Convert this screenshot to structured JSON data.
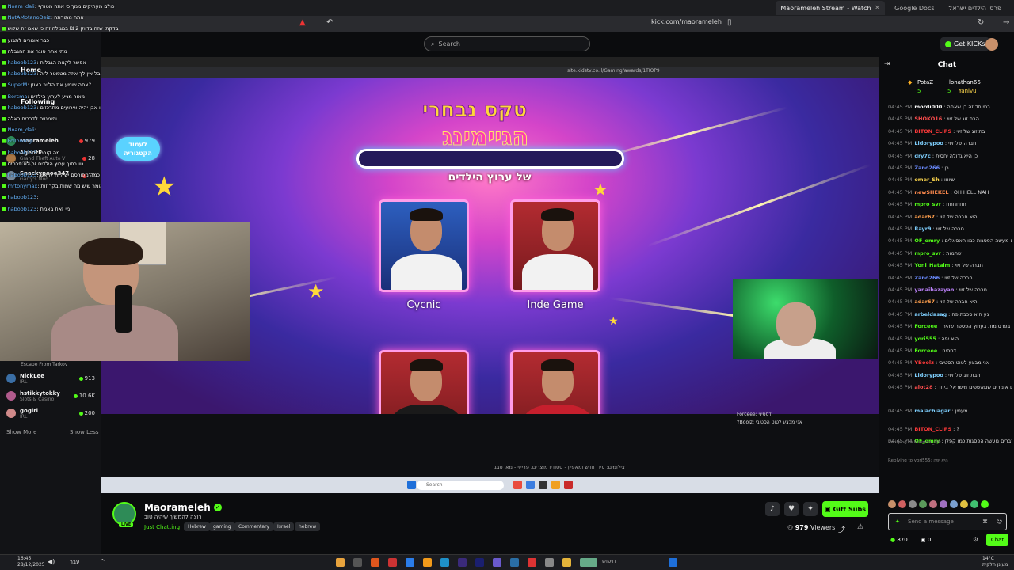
{
  "browser": {
    "tabs": [
      {
        "label": "Maorameleh Stream - Watch",
        "active": true
      },
      {
        "label": "Google Docs",
        "active": false
      },
      {
        "label": "פרסי הילדים ישראל",
        "active": false
      }
    ],
    "url": "kick.com/maorameleh"
  },
  "kick_header": {
    "search_placeholder": "Search",
    "get_kicks_label": "Get KICKs"
  },
  "sidebar": {
    "home": "Home",
    "following": "Following",
    "channels": [
      {
        "name": "Maorameleh",
        "category": "",
        "viewers": "979"
      },
      {
        "name": "AgentF",
        "category": "Grand Theft Auto V (GTA)",
        "viewers": "28"
      },
      {
        "name": "Snackypooe247",
        "category": "Garry's Mod",
        "viewers": "10"
      },
      {
        "name": "Escape From Tarkov",
        "category": "",
        "viewers": ""
      },
      {
        "name": "NickLee",
        "category": "IRL",
        "viewers": "913"
      },
      {
        "name": "hstikkytokky",
        "category": "Slots & Casino",
        "viewers": "10.6K"
      },
      {
        "name": "gogirl",
        "category": "IRL",
        "viewers": "200"
      }
    ],
    "show_more": "Show More",
    "show_less": "Show Less"
  },
  "overlay_chat": [
    {
      "user": "Noam_dali",
      "text": "כולם מעתיקים ממך כי אתה מטורף"
    },
    {
      "user": "NotAMotanoDeiz",
      "text": "אתה מתורתה"
    },
    {
      "user": "",
      "text": "בדקתי שזה בדיוק 2 ₪ במגילה זה כי שאם זה שלוש"
    },
    {
      "user": "",
      "text": "כבר אומרים לתבוע"
    },
    {
      "user": "",
      "text": "מתי אתה סוגר את ההגבלה"
    },
    {
      "user": "haboob123",
      "text": "אפשר לקנות הגבלות"
    },
    {
      "user": "haboob123",
      "text": "הבל אין לך איזה מטמטר לזה"
    },
    {
      "user": "SuperM",
      "text": "אתה שומע את הלייב באוזן?"
    },
    {
      "user": "Borsma",
      "text": "מאור מגיע לערוץ הילדים"
    },
    {
      "user": "haboob123",
      "text": "רק ברגע שהקטגוריה תהיה מאושרת כמו אבן יהיה אירועים מתרכזים"
    },
    {
      "user": "",
      "text": "ופומטים לדברים כאלה"
    },
    {
      "user": "Noam_dali",
      "text": ""
    },
    {
      "user": "Followingl",
      "text": ""
    },
    {
      "user": "haboob123",
      "text": "מה קורה"
    },
    {
      "user": "",
      "text": "טו בתוך ערוץ הילדים זה לא פרסים"
    },
    {
      "user": "haboob123",
      "text": "שתראה כמה מפורסם יש לזה לראש"
    },
    {
      "user": "mrtonymax",
      "text": "מה אומר שיש מה שמות בקרוזות?"
    },
    {
      "user": "haboob123",
      "text": ""
    },
    {
      "user": "haboob123",
      "text": "מי זאת באמת"
    }
  ],
  "video": {
    "inner_url": "site.kidstv.co.il/Gaming/awards/1TIOP9",
    "inner_button": "לעמוד הקטגוריה",
    "logo_line1": "טקס נבחרי",
    "logo_line2": "הגיימינג",
    "subtitle": "של ערוץ הילדים",
    "nominees": [
      {
        "name": "Cycnic"
      },
      {
        "name": "Inde Game"
      },
      {
        "name": ""
      },
      {
        "name": ""
      }
    ],
    "ticker": "צילומים: עידן חדש ומאפיין - סטודיו מוצרים, פרייזי - מאי סבג",
    "mini_legend": [
      "Forceee: דססיני",
      "YBoolz: אני מבצע לטוט הסטיבי"
    ],
    "inner_taskbar_search": "Search"
  },
  "stream_info": {
    "streamer": "Maorameleh",
    "live_badge": "LIVE",
    "title": "רוצה להמשיך שיהיה טוב",
    "category": "Just Chatting",
    "tags": [
      "Hebrew",
      "gaming",
      "Commentary",
      "Israel",
      "hebrew"
    ],
    "gift_subs": "Gift Subs",
    "viewers_count": "979",
    "viewers_label": "Viewers"
  },
  "chat": {
    "title": "Chat",
    "pinned": [
      {
        "user": "PotaZ",
        "count": "5"
      },
      {
        "user": "lonathan66",
        "count": "5"
      },
      {
        "user": "Yanivu",
        "count": "5"
      }
    ],
    "messages": [
      {
        "time": "04:45 PM",
        "user": "mordi000",
        "color": "#ffffff",
        "text": "במיוחד זה כן שאתה"
      },
      {
        "time": "04:45 PM",
        "user": "SHOKO16",
        "color": "#ff4d4d",
        "text": "הבת זוג של זיוי"
      },
      {
        "time": "04:45 PM",
        "user": "BITON_CLIPS",
        "color": "#ff3a3a",
        "text": "בת זוג של זיוי"
      },
      {
        "time": "04:45 PM",
        "user": "Lidorypoo",
        "color": "#7fd0ff",
        "text": "חברה של זיוי"
      },
      {
        "time": "04:45 PM",
        "user": "dry7c",
        "color": "#7fd0ff",
        "text": "כן היא גדולה יחסית"
      },
      {
        "time": "04:45 PM",
        "user": "Zano266",
        "color": "#6b8bff",
        "text": "כן"
      },
      {
        "time": "04:45 PM",
        "user": "omer_Sh",
        "color": "#ffd84d",
        "text": "שיוווו"
      },
      {
        "time": "04:45 PM",
        "user": "newSHEKEL",
        "color": "#ff8a4d",
        "text": "OH HELL NAH"
      },
      {
        "time": "04:45 PM",
        "user": "mpro_svr",
        "color": "#53fc18",
        "text": "חחחחחח"
      },
      {
        "time": "04:45 PM",
        "user": "adar67",
        "color": "#ff9f4d",
        "text": "היא חברה של זיוי"
      },
      {
        "time": "04:45 PM",
        "user": "Rayr9",
        "color": "#7fd0ff",
        "text": "חברה של זיוי"
      },
      {
        "time": "04:45 PM",
        "user": "OF_omry",
        "color": "#53fc18",
        "text": "אתם רק מדברים מעשה הפסגות כמו האסאלים"
      },
      {
        "time": "04:45 PM",
        "user": "mpro_svr",
        "color": "#53fc18",
        "text": "שתמות"
      },
      {
        "time": "04:45 PM",
        "user": "Yoni_Hataim",
        "color": "#53fc18",
        "text": "חברה של זיוי"
      },
      {
        "time": "04:45 PM",
        "user": "Zano266",
        "color": "#6b8bff",
        "text": "חברה של זיוי"
      },
      {
        "time": "04:45 PM",
        "user": "yanaihazayan",
        "color": "#c084ff",
        "text": "חברה של זיוי"
      },
      {
        "time": "04:45 PM",
        "user": "adar67",
        "color": "#ff9f4d",
        "text": "היא חברה של זיוי"
      },
      {
        "time": "04:45 PM",
        "user": "arbeldasag",
        "color": "#7fd0ff",
        "text": "נע היא סכבת פח"
      },
      {
        "time": "04:45 PM",
        "user": "Forceee",
        "color": "#53fc18",
        "text": "היא בפרסומות בערוץ הפספר שהיה"
      },
      {
        "time": "04:45 PM",
        "user": "yori555",
        "color": "#53fc18",
        "text": "היא יפה"
      },
      {
        "time": "04:45 PM",
        "user": "Forceee",
        "color": "#53fc18",
        "text": "דססיני"
      },
      {
        "time": "04:45 PM",
        "user": "YBoolz",
        "color": "#ff3a3a",
        "text": "אני מבצע לטוט הסטיבי"
      },
      {
        "time": "04:45 PM",
        "user": "Lidorypoo",
        "color": "#7fd0ff",
        "text": "הבת זוג של זיוי"
      },
      {
        "time": "04:45 PM",
        "user": "alot28",
        "color": "#ff4d4d",
        "text": "תמיד אתם אומרים שמאשפים מישראל ביחד"
      },
      {
        "time": "04:45 PM",
        "user": "malachiagar",
        "color": "#7fd0ff",
        "text": "מעניין"
      },
      {
        "time": "04:45 PM",
        "user": "BITON_CLIPS",
        "color": "#ff3a3a",
        "text": "?"
      },
      {
        "time": "04:45 PM",
        "user": "OF_omry",
        "color": "#53fc18",
        "text": "אתם רק מדברים מעשה הפסגות כמו קפלן"
      }
    ],
    "replies": [
      "Replying to Musmus_08: ",
      "Replying to yori555: היא יפה"
    ],
    "input_placeholder": "Send a message",
    "kicks_balance": "870",
    "other_count": "0",
    "chat_button": "Chat"
  },
  "windows_taskbar": {
    "time": "16:45",
    "date": "28/12/2025",
    "lang": "עבר",
    "search": "חיפוש",
    "temp": "14°C",
    "weather": "מעונן חלקית"
  }
}
